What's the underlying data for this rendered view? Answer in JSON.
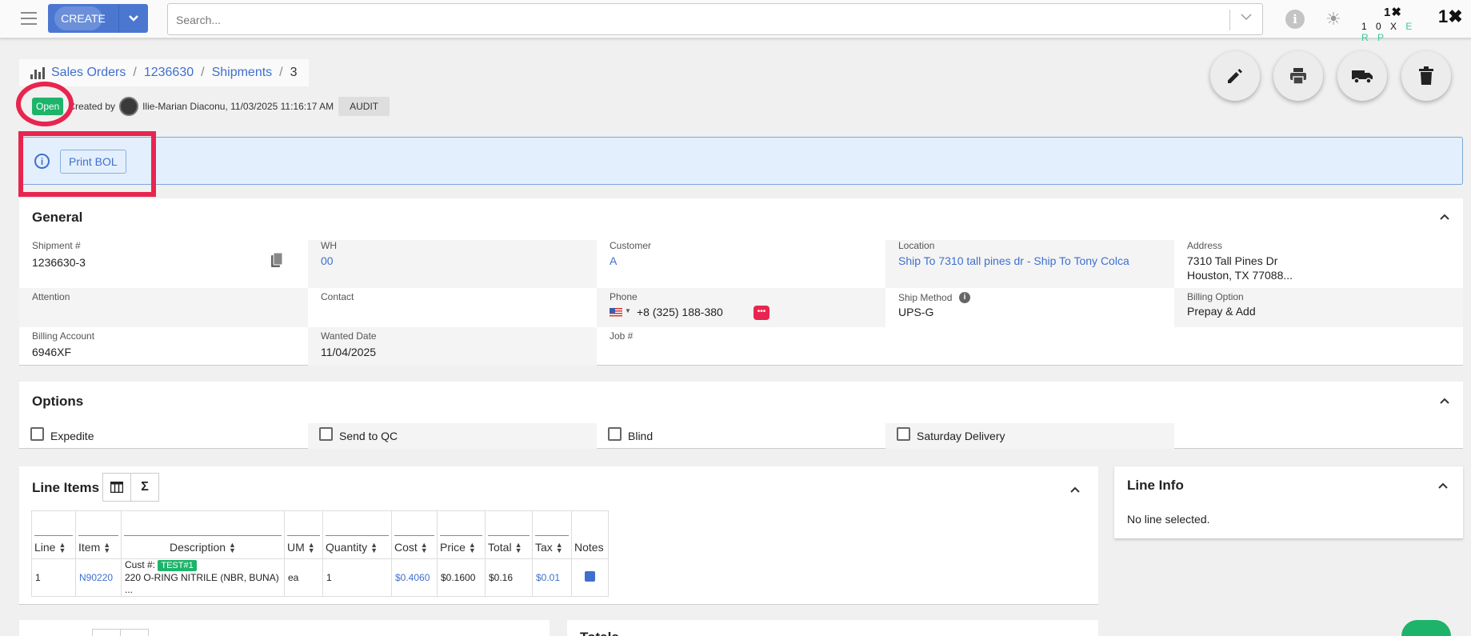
{
  "topbar": {
    "create_label": "CREATE",
    "search_placeholder": "Search...",
    "logo_mark": "1✖",
    "logo_word_a": "1 0 X",
    "logo_word_b": "E R P",
    "logo2": "1✖"
  },
  "breadcrumb": {
    "items": [
      "Sales Orders",
      "1236630",
      "Shipments"
    ],
    "current": "3"
  },
  "meta": {
    "status": "Open",
    "created_by_label": "Created by",
    "creator": "Ilie-Marian Diaconu, 11/03/2025 11:16:17 AM",
    "audit_label": "AUDIT"
  },
  "banner": {
    "print_bol_label": "Print BOL"
  },
  "general": {
    "title": "General",
    "shipment_label": "Shipment #",
    "shipment_value": "1236630-3",
    "wh_label": "WH",
    "wh_value": "00",
    "customer_label": "Customer",
    "customer_value": "A",
    "location_label": "Location",
    "location_value": "Ship To 7310 tall pines dr - Ship To Tony Colca",
    "address_label": "Address",
    "address_line1": "7310 Tall Pines Dr",
    "address_line2": "Houston, TX 77088...",
    "attention_label": "Attention",
    "contact_label": "Contact",
    "phone_label": "Phone",
    "phone_value": "+8 (325) 188-380",
    "ship_method_label": "Ship Method",
    "ship_method_value": "UPS-G",
    "billing_option_label": "Billing Option",
    "billing_option_value": "Prepay & Add",
    "billing_account_label": "Billing Account",
    "billing_account_value": "6946XF",
    "wanted_date_label": "Wanted Date",
    "wanted_date_value": "11/04/2025",
    "job_label": "Job #"
  },
  "options": {
    "title": "Options",
    "expedite": "Expedite",
    "send_to_qc": "Send to QC",
    "blind": "Blind",
    "saturday_delivery": "Saturday Delivery"
  },
  "line_items": {
    "title": "Line Items",
    "columns": [
      "Line",
      "Item",
      "Description",
      "UM",
      "Quantity",
      "Cost",
      "Price",
      "Total",
      "Tax",
      "Notes"
    ],
    "row": {
      "line": "1",
      "item": "N90220",
      "cust_label": "Cust #:",
      "cust_tag": "TEST#1",
      "description": "220 O-RING NITRILE (NBR, BUNA) ...",
      "um": "ea",
      "quantity": "1",
      "cost": "$0.4060",
      "price": "$0.1600",
      "total": "$0.16",
      "tax": "$0.01"
    }
  },
  "line_info": {
    "title": "Line Info",
    "empty": "No line selected."
  },
  "totals": {
    "title": "Totals"
  },
  "colors": {
    "accent": "#4b77d1",
    "link": "#3f6fce",
    "success": "#1db46a",
    "highlight": "#e8254f",
    "banner_bg": "#e3effc"
  }
}
